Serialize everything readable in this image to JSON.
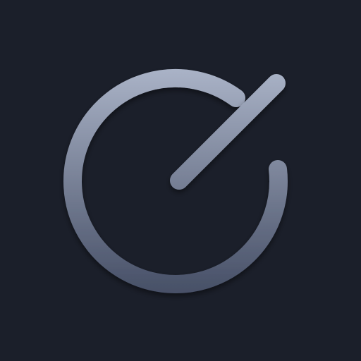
{
  "icon": {
    "name": "dial-gauge-icon",
    "background_color": "#1b1f2a",
    "stroke_color_top": "#a9b2c6",
    "stroke_color_bottom": "#485168"
  }
}
